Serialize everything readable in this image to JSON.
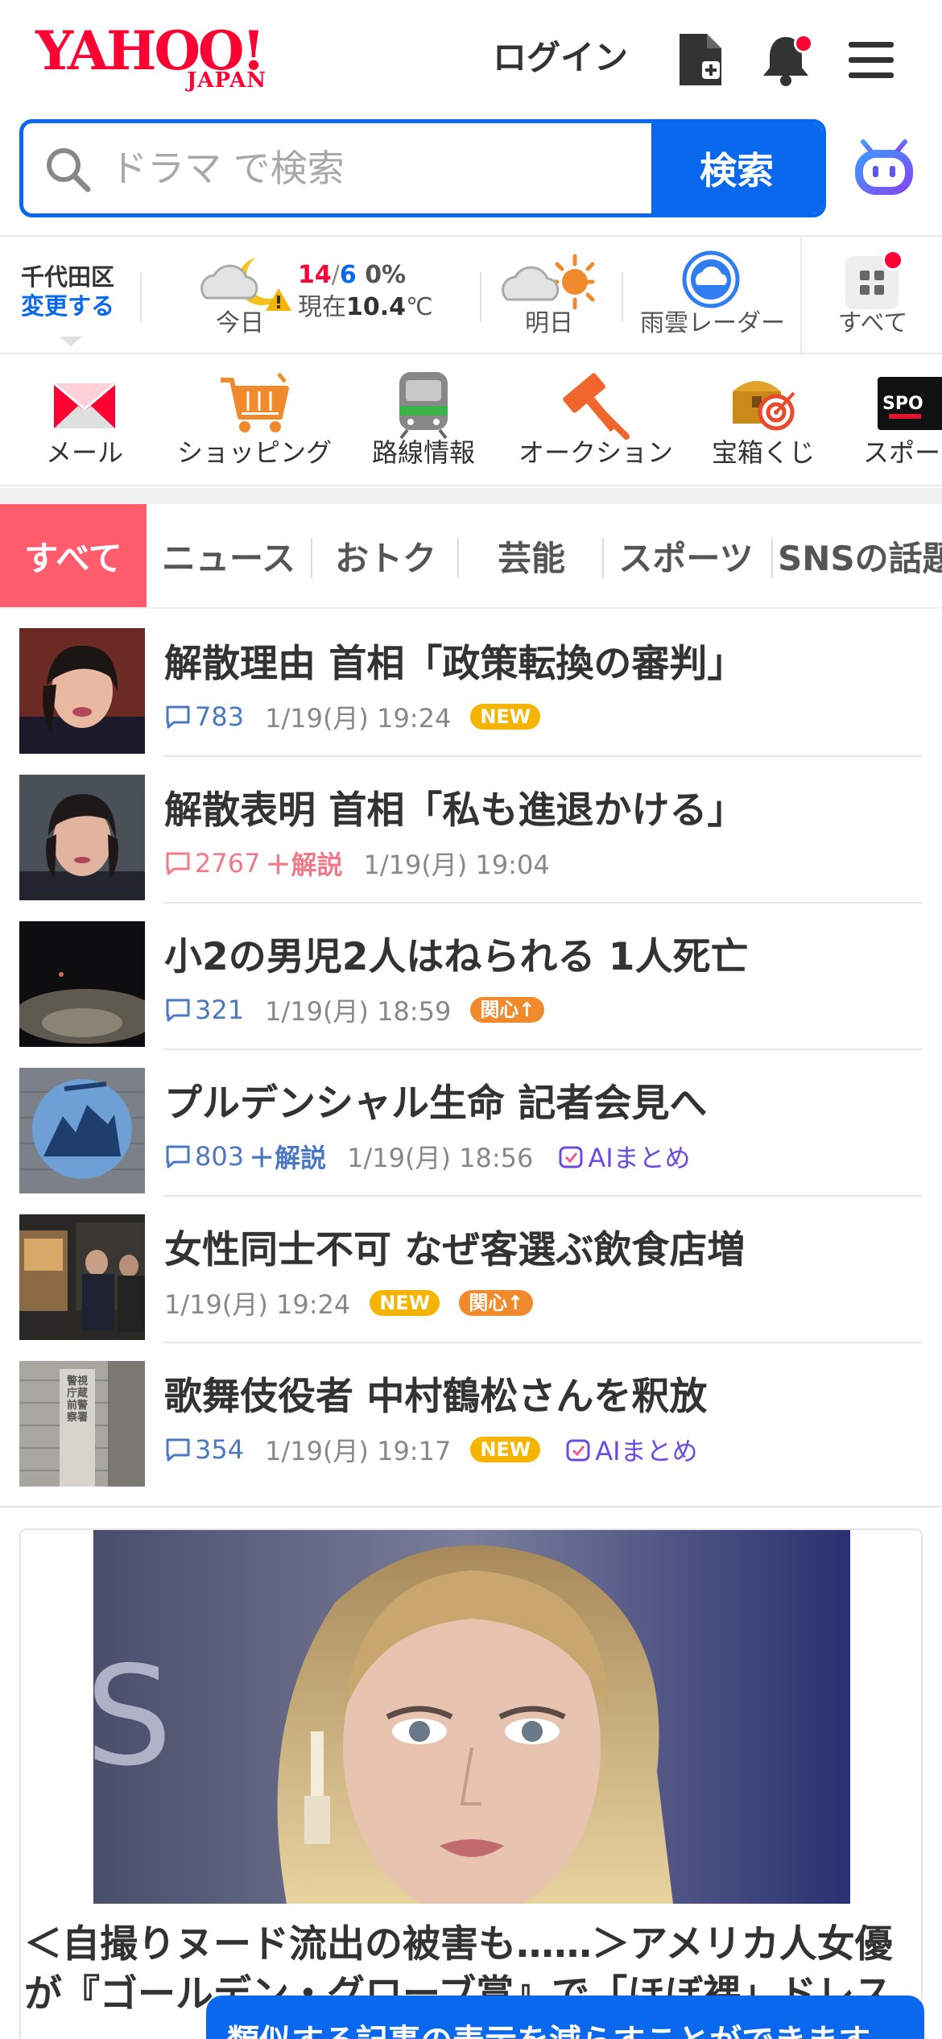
{
  "header": {
    "logo_main": "YAHOO!",
    "logo_sub": "JAPAN",
    "login_label": "ログイン"
  },
  "search": {
    "placeholder": "ドラマ で検索",
    "button_label": "検索"
  },
  "weather": {
    "area_name": "千代田区",
    "change_label": "変更する",
    "today_label": "今日",
    "high": "14",
    "slash": "/",
    "low": "6",
    "precip": "0%",
    "now_prefix": "現在",
    "now_value": "10.4",
    "now_unit": "℃",
    "tomorrow_label": "明日",
    "radar_label": "雨雲レーダー",
    "all_label": "すべて"
  },
  "services": [
    {
      "label": "メール",
      "icon": "mail-icon"
    },
    {
      "label": "ショッピング",
      "icon": "cart-icon"
    },
    {
      "label": "路線情報",
      "icon": "train-icon"
    },
    {
      "label": "オークション",
      "icon": "auction-hammer-icon"
    },
    {
      "label": "宝箱くじ",
      "icon": "treasure-box-icon"
    },
    {
      "label": "スポーツ",
      "icon": "sports-icon"
    }
  ],
  "tabs": [
    {
      "label": "すべて",
      "active": true
    },
    {
      "label": "ニュース"
    },
    {
      "label": "おトク"
    },
    {
      "label": "芸能"
    },
    {
      "label": "スポーツ"
    },
    {
      "label": "SNSの話題"
    }
  ],
  "news": [
    {
      "headline": "解散理由 首相「政策転換の審判」",
      "comments": "783",
      "time": "1/19(月) 19:24",
      "badge": "NEW"
    },
    {
      "headline": "解散表明 首相「私も進退かける」",
      "comments": "2767",
      "kaisetsu": "＋解説",
      "time": "1/19(月) 19:04"
    },
    {
      "headline": "小2の男児2人はねられる 1人死亡",
      "comments": "321",
      "time": "1/19(月) 18:59",
      "badge": "関心↑"
    },
    {
      "headline": "プルデンシャル生命 記者会見へ",
      "comments": "803",
      "kaisetsu": "＋解説",
      "time": "1/19(月) 18:56",
      "ai": "AIまとめ"
    },
    {
      "headline": "女性同士不可 なぜ客選ぶ飲食店増",
      "time": "1/19(月) 19:24",
      "badge": "NEW",
      "badge2": "関心↑"
    },
    {
      "headline": "歌舞伎役者 中村鶴松さんを釈放",
      "comments": "354",
      "time": "1/19(月) 19:17",
      "badge": "NEW",
      "ai": "AIまとめ"
    }
  ],
  "feature": {
    "title": "＜自撮りヌード流出の被害も……＞アメリカ人女優が『ゴールデン・グローブ賞』で「ほぼ裸」ドレス"
  },
  "thumbnail_text": {
    "sign": "警視庁蔵前警察署"
  },
  "toast": {
    "text": "類似する記事の表示を減らすことができます"
  },
  "colors": {
    "brand_red": "#ff0033",
    "accent_blue": "#0a68ee",
    "tab_active": "#ff5c6e",
    "ai_purple": "#6a4ce0",
    "new_badge": "#f5b400"
  }
}
